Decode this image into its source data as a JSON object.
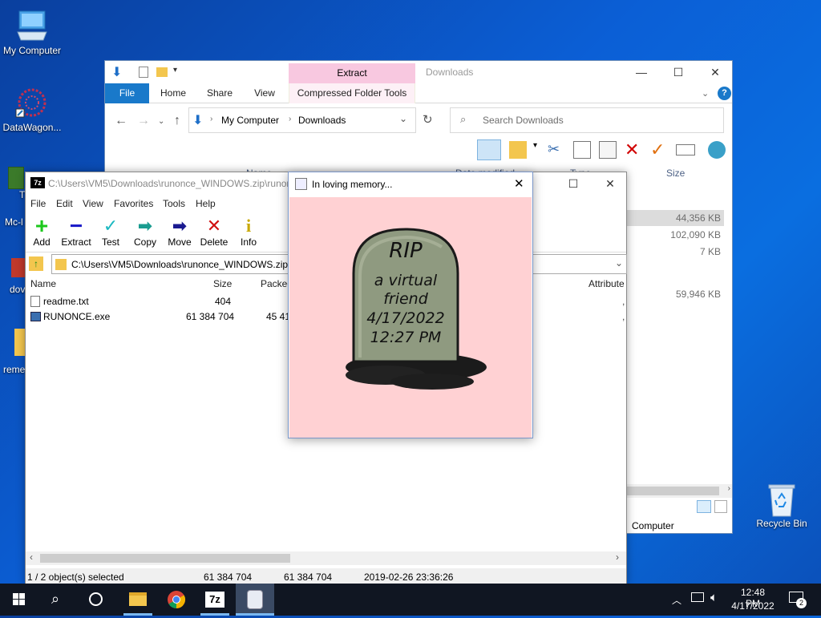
{
  "desktop": {
    "icons": [
      {
        "label": "My Computer"
      },
      {
        "label": "DataWagon..."
      },
      {
        "label": "Recycle Bin"
      }
    ],
    "partial_labels": [
      "T",
      "Mc-l",
      "dov",
      "reme"
    ]
  },
  "explorer": {
    "title": "Downloads",
    "context_tab_header": "Extract",
    "tabs": {
      "file": "File",
      "home": "Home",
      "share": "Share",
      "view": "View",
      "compressed": "Compressed Folder Tools"
    },
    "breadcrumb": [
      "My Computer",
      "Downloads"
    ],
    "search_placeholder": "Search Downloads",
    "columns": {
      "name": "Name",
      "date": "Date modified",
      "type": "Type",
      "size": "Size"
    },
    "sizes": [
      "44,356 KB",
      "102,090 KB",
      "7 KB",
      "59,946 KB"
    ],
    "nav_item": "Computer"
  },
  "sevenzip": {
    "title": "C:\\Users\\VM5\\Downloads\\runonce_WINDOWS.zip\\runon",
    "menu": [
      "File",
      "Edit",
      "View",
      "Favorites",
      "Tools",
      "Help"
    ],
    "toolbar": [
      "Add",
      "Extract",
      "Test",
      "Copy",
      "Move",
      "Delete",
      "Info"
    ],
    "path": "C:\\Users\\VM5\\Downloads\\runonce_WINDOWS.zip\\",
    "columns": {
      "name": "Name",
      "size": "Size",
      "packed": "Packed",
      "attributes": "Attribute"
    },
    "files": [
      {
        "name": "readme.txt",
        "size": "404",
        "packed": ""
      },
      {
        "name": "RUNONCE.exe",
        "size": "61 384 704",
        "packed": "45 41"
      }
    ],
    "status": {
      "selection": "1 / 2 object(s) selected",
      "size": "61 384 704",
      "packed": "61 384 704",
      "modified": "2019-02-26 23:36:26"
    }
  },
  "memorial": {
    "title": "In loving memory...",
    "tombstone_lines": [
      "RIP",
      "a virtual",
      "friend",
      "4/17/2022",
      "12:27 PM"
    ]
  },
  "taskbar": {
    "time": "12:48 PM",
    "date": "4/17/2022",
    "notification_count": "2",
    "pinned": [
      "start-icon",
      "search-icon",
      "task-view-icon",
      "file-explorer-icon",
      "chrome-icon",
      "7zip-icon",
      "clippy-icon"
    ]
  },
  "colors": {
    "ribbon_file": "#1979ca",
    "context_header": "#f8c8e0",
    "memorial_bg": "#ffd1d3",
    "taskbar": "#101622"
  }
}
